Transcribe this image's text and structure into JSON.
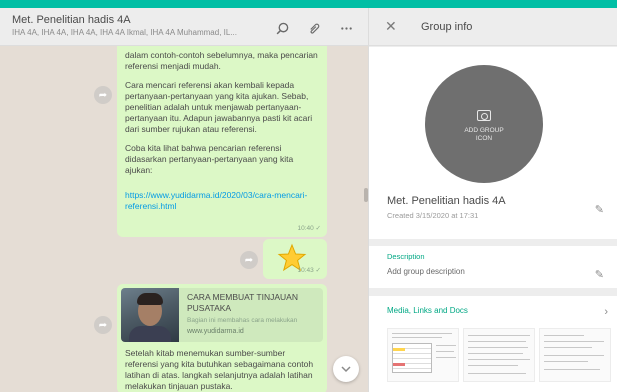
{
  "chat": {
    "title": "Met. Penelitian hadis 4A",
    "subtitle": "IHA 4A, IHA 4A, IHA 4A, IHA 4A Ikmal, IHA 4A Muhammad, IL...",
    "icons": [
      "search-icon",
      "attach-icon",
      "menu-icon"
    ],
    "message1": {
      "p1": "dalam contoh-contoh sebelumnya, maka pencarian referensi menjadi mudah.",
      "p2": "Cara mencari referensi akan kembali kepada pertanyaan-pertanyaan yang kita ajukan. Sebab, penelitian adalah untuk menjawab pertanyaan-pertanyaan itu. Adapun jawabannya pasti kit acari dari sumber rujukan atau referensi.",
      "p3": "Coba kita lihat bahwa pencarian referensi didasarkan pertanyaan-pertanyaan yang kita ajukan:",
      "link": "https://www.yudidarma.id/2020/03/cara-mencari-referensi.html",
      "time": "10:40 ✓"
    },
    "message2": {
      "time": "10:43 ✓"
    },
    "message3": {
      "preview_title": "CARA MEMBUAT TINJAUAN PUSATAKA",
      "preview_desc": "Bagian ini membahas cara melakukan",
      "preview_url": "www.yudidarma.id",
      "body": "Setelah kitab menemukan sumber-sumber referensi yang kita butuhkan sebagaimana contoh latihan di atas. langkah selanjutnya adalah latihan melakukan tinjauan pustaka."
    }
  },
  "info": {
    "header_title": "Group info",
    "add_icon_label_1": "ADD GROUP",
    "add_icon_label_2": "ICON",
    "group_name": "Met. Penelitian hadis 4A",
    "created": "Created 3/15/2020 at 17:31",
    "description_label": "Description",
    "description_value": "Add group description",
    "media_label": "Media, Links and Docs"
  },
  "colors": {
    "accent": "#00bfa5",
    "bubble": "#dcf8c6",
    "link": "#039be5",
    "section_label": "#00a884"
  }
}
